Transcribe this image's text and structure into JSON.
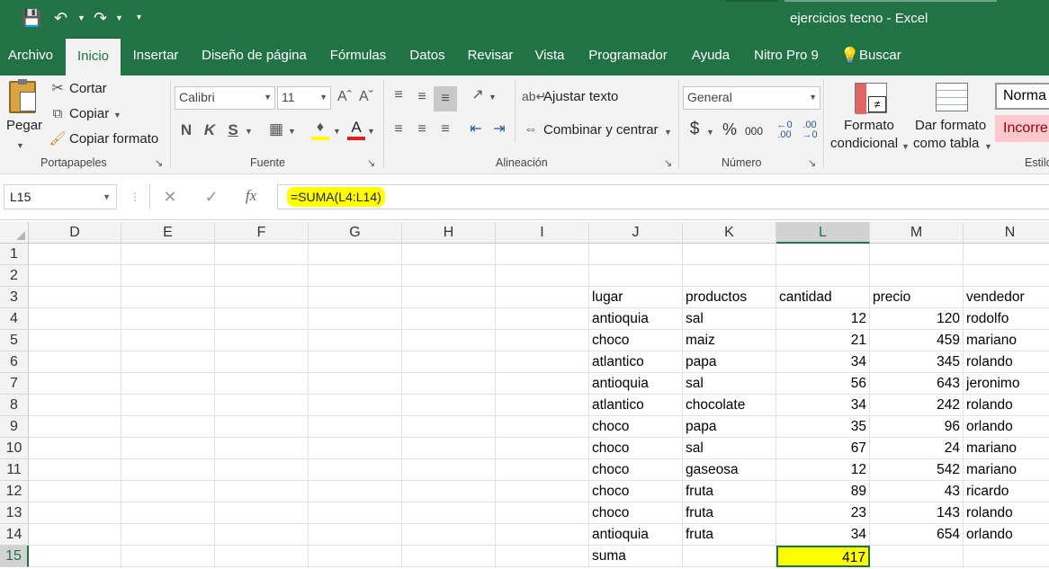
{
  "app": {
    "doc_title": "ejercicios tecno  -  Excel"
  },
  "menu": {
    "tabs": [
      "Archivo",
      "Inicio",
      "Insertar",
      "Diseño de página",
      "Fórmulas",
      "Datos",
      "Revisar",
      "Vista",
      "Programador",
      "Ayuda",
      "Nitro Pro 9",
      "Buscar"
    ],
    "active": "Inicio"
  },
  "ribbon": {
    "clipboard": {
      "paste": "Pegar",
      "cut": "Cortar",
      "copy": "Copiar",
      "format_painter": "Copiar formato",
      "label": "Portapapeles"
    },
    "font": {
      "name": "Calibri",
      "size": "11",
      "bold": "N",
      "italic": "K",
      "underline": "S",
      "label": "Fuente"
    },
    "alignment": {
      "wrap": "Ajustar texto",
      "merge": "Combinar y centrar",
      "label": "Alineación"
    },
    "number": {
      "format": "General",
      "currency": "$",
      "percent": "%",
      "thousands": "000",
      "label": "Número"
    },
    "styles": {
      "cond_format": [
        "Formato",
        "condicional"
      ],
      "table_format": [
        "Dar formato",
        "como tabla"
      ],
      "normal": "Norma",
      "bad": "Incorre",
      "label": "Estilo"
    }
  },
  "formula_bar": {
    "name_box": "L15",
    "fx": "fx",
    "formula": "=SUMA(L4:L14)"
  },
  "colors": {
    "accent": "#217346",
    "highlight": "#ffff00",
    "bad_bg": "#ffc7ce",
    "bad_fg": "#9c0006"
  },
  "columns": [
    "D",
    "E",
    "F",
    "G",
    "H",
    "I",
    "J",
    "K",
    "L",
    "M",
    "N"
  ],
  "selected_column": "L",
  "rows": [
    "1",
    "2",
    "3",
    "4",
    "5",
    "6",
    "7",
    "8",
    "9",
    "10",
    "11",
    "12",
    "13",
    "14",
    "15"
  ],
  "selected_row": "15",
  "table": {
    "headers": [
      " lugar",
      "productos",
      "cantidad",
      "precio",
      "vendedor"
    ],
    "rows": [
      [
        "antioquia",
        "sal",
        "12",
        "120",
        "rodolfo"
      ],
      [
        "choco",
        "maiz",
        "21",
        "459",
        "mariano"
      ],
      [
        "atlantico",
        "papa",
        "34",
        "345",
        "rolando"
      ],
      [
        "antioquia",
        "sal",
        "56",
        "643",
        "jeronimo"
      ],
      [
        "atlantico",
        "chocolate",
        "34",
        "242",
        "rolando"
      ],
      [
        "choco",
        "papa",
        "35",
        "96",
        "orlando"
      ],
      [
        "choco",
        "sal",
        "67",
        "24",
        "mariano"
      ],
      [
        "choco",
        "gaseosa",
        "12",
        "542",
        "mariano"
      ],
      [
        "choco",
        "fruta",
        "89",
        "43",
        "ricardo"
      ],
      [
        "choco",
        "fruta",
        "23",
        "143",
        "rolando"
      ],
      [
        "antioquia",
        "fruta",
        "34",
        "654",
        "orlando"
      ]
    ],
    "total_label": "suma",
    "total_value": "417"
  }
}
